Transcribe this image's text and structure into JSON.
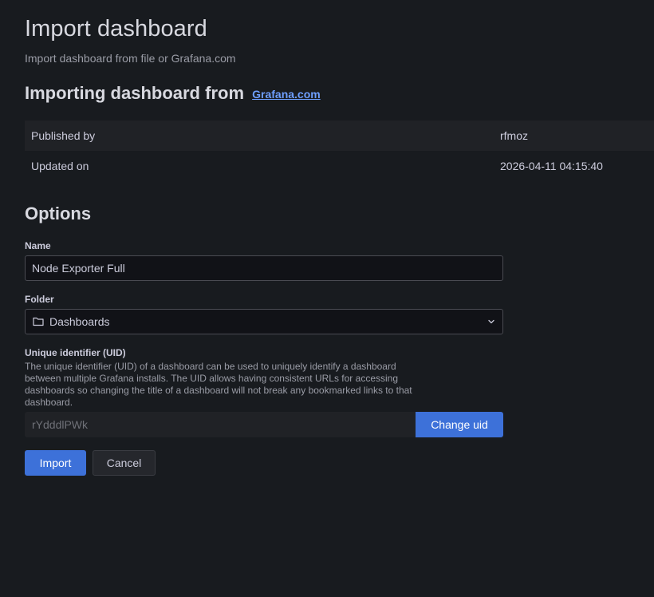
{
  "page": {
    "title": "Import dashboard",
    "subtitle": "Import dashboard from file or Grafana.com"
  },
  "source": {
    "heading": "Importing dashboard from",
    "link_text": "Grafana.com"
  },
  "info": {
    "published_label": "Published by",
    "published_value": "rfmoz",
    "updated_label": "Updated on",
    "updated_value": "2026-04-11 04:15:40"
  },
  "options": {
    "heading": "Options",
    "name_label": "Name",
    "name_value": "Node Exporter Full",
    "folder_label": "Folder",
    "folder_value": "Dashboards",
    "uid_label": "Unique identifier (UID)",
    "uid_description": "The unique identifier (UID) of a dashboard can be used to uniquely identify a dashboard between multiple Grafana installs. The UID allows having consistent URLs for accessing dashboards so changing the title of a dashboard will not break any bookmarked links to that dashboard.",
    "uid_value": "rYdddlPWk",
    "change_uid_label": "Change uid"
  },
  "actions": {
    "import_label": "Import",
    "cancel_label": "Cancel"
  },
  "icons": {
    "folder": "folder-icon",
    "chevron": "chevron-down-icon"
  }
}
